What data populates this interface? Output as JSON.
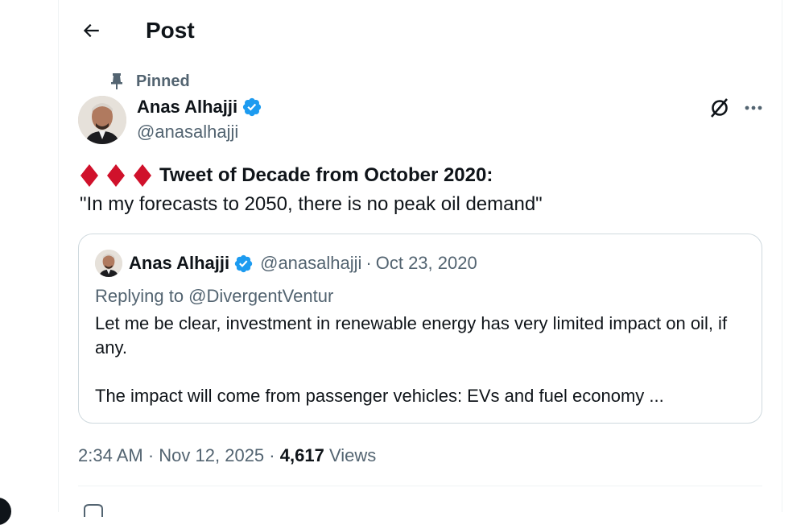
{
  "header": {
    "title": "Post"
  },
  "tweet": {
    "pinned_label": "Pinned",
    "author": {
      "name": "Anas Alhajji",
      "handle": "@anasalhajji"
    },
    "text_line1": "Tweet of Decade from October 2020:",
    "text_line2": "\"In my forecasts to 2050, there is no peak oil demand\"",
    "quote": {
      "author_name": "Anas Alhajji",
      "handle": "@anasalhajji",
      "separator": "·",
      "date": "Oct 23, 2020",
      "replying_to": "Replying to @DivergentVentur",
      "body_p1": "Let me be clear, investment in renewable energy has very limited impact on oil, if any.",
      "body_p2": "The impact will come from passenger vehicles: EVs and fuel economy ..."
    },
    "meta": {
      "time": "2:34 AM",
      "sep1": "·",
      "date": "Nov 12, 2025",
      "sep2": "·",
      "views_count": "4,617",
      "views_label": "Views"
    }
  },
  "colors": {
    "text_primary": "#0f1419",
    "text_secondary": "#536471",
    "verified_blue": "#1d9bf0",
    "diamond_red": "#d0112b",
    "border": "#cfd9de"
  },
  "icons": {
    "back": "arrow-left-icon",
    "pin": "pin-icon",
    "verified": "verified-badge-icon",
    "grok": "grok-icon",
    "more": "more-horizontal-icon",
    "diamond": "red-diamond-emoji"
  }
}
